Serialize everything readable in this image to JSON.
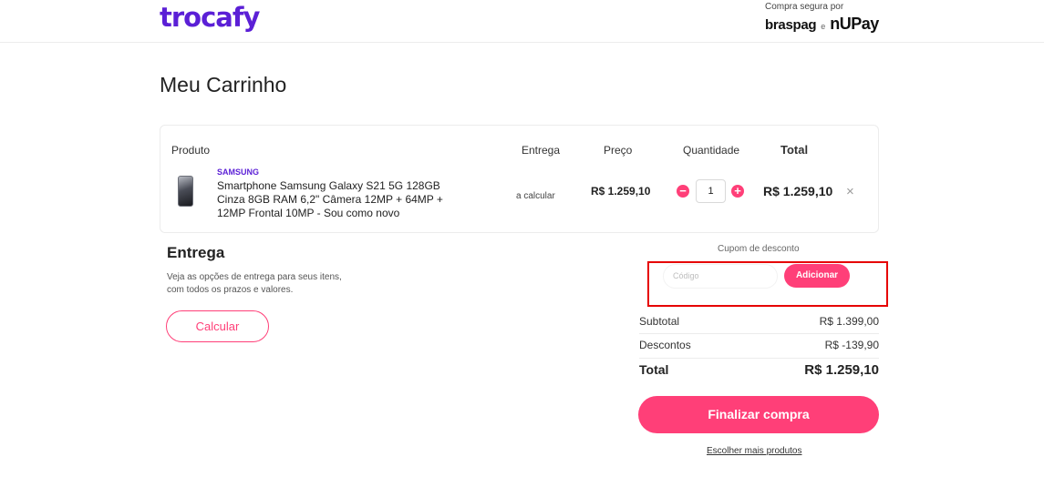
{
  "header": {
    "logo": "trocafy",
    "secure_label": "Compra segura por",
    "partner1": "braspag",
    "partner_sep": "e",
    "partner2": "nUPay"
  },
  "page": {
    "title": "Meu Carrinho"
  },
  "cart": {
    "columns": {
      "product": "Produto",
      "delivery": "Entrega",
      "price": "Preço",
      "quantity": "Quantidade",
      "total": "Total"
    },
    "item": {
      "brand": "SAMSUNG",
      "name": "Smartphone Samsung Galaxy S21 5G 128GB Cinza 8GB RAM 6,2\" Câmera 12MP + 64MP + 12MP Frontal 10MP - Sou como novo",
      "delivery": "a calcular",
      "price": "R$ 1.259,10",
      "quantity": "1",
      "total": "R$ 1.259,10",
      "remove_icon": "×",
      "minus_icon": "−",
      "plus_icon": "+"
    }
  },
  "shipping": {
    "title": "Entrega",
    "description": "Veja as opções de entrega para seus itens, com todos os prazos e valores.",
    "button": "Calcular"
  },
  "coupon": {
    "label": "Cupom de desconto",
    "placeholder": "Código",
    "button": "Adicionar"
  },
  "summary": {
    "subtotal_label": "Subtotal",
    "subtotal_value": "R$ 1.399,00",
    "discount_label": "Descontos",
    "discount_value": "R$ -139,90",
    "total_label": "Total",
    "total_value": "R$ 1.259,10"
  },
  "checkout_button": "Finalizar compra",
  "more_products_link": "Escolher mais produtos",
  "colors": {
    "brand": "#5b1fd6",
    "accent": "#ff3f78",
    "highlight": "#e60000"
  }
}
